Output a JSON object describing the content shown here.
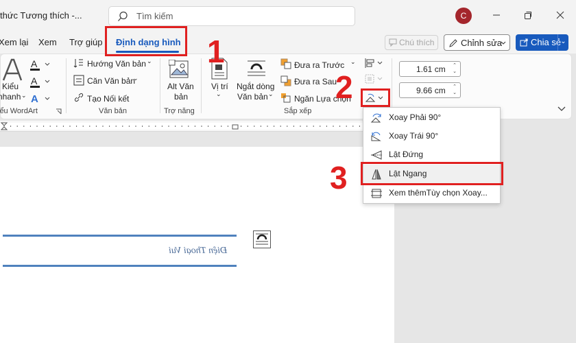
{
  "titlebar": {
    "doc_title": "thức Tương thích  -...",
    "search_placeholder": "Tìm kiếm",
    "avatar_initial": "C"
  },
  "tabs": [
    {
      "label": "Xem lại"
    },
    {
      "label": "Xem"
    },
    {
      "label": "Trợ giúp"
    },
    {
      "label": "Định dạng hình"
    }
  ],
  "actions": {
    "comment": "Chú thích",
    "edit": "Chỉnh sửa",
    "share": "Chia sẻ"
  },
  "ribbon": {
    "wordart": {
      "styles_label_1": "Kiểu",
      "styles_label_2": "nhanh",
      "group_label": "iểu WordArt"
    },
    "text": {
      "direction": "Hướng Văn bản",
      "align": "Căn Văn bản",
      "link": "Tạo Nối kết",
      "group_label": "Văn bản"
    },
    "accessibility": {
      "alt_text_1": "Alt Văn",
      "alt_text_2": "bản",
      "group_label": "Trợ năng"
    },
    "arrange": {
      "position": "Vị trí",
      "wrap_1": "Ngắt dòng",
      "wrap_2": "Văn bản",
      "bring_forward": "Đưa ra Trước",
      "send_backward": "Đưa ra Sau",
      "selection_pane": "Ngăn Lựa chọn",
      "group_label": "Sắp xếp"
    },
    "size": {
      "height": "1.61 cm",
      "width": "9.66 cm"
    }
  },
  "document": {
    "wordart_text": "Điện Thoại Vui"
  },
  "rotate_menu": {
    "items": [
      {
        "label": "Xoay Phải 90°"
      },
      {
        "label": "Xoay Trái 90°"
      },
      {
        "label": "Lật Đứng"
      },
      {
        "label": "Lật Ngang"
      },
      {
        "label": "Xem thêmTùy chọn Xoay..."
      }
    ]
  },
  "annotations": {
    "step1": "1",
    "step2": "2",
    "step3": "3"
  },
  "colors": {
    "accent": "#185abd",
    "annotation": "#e02020",
    "wordart": "#4f81bd",
    "avatar": "#a4262c"
  }
}
